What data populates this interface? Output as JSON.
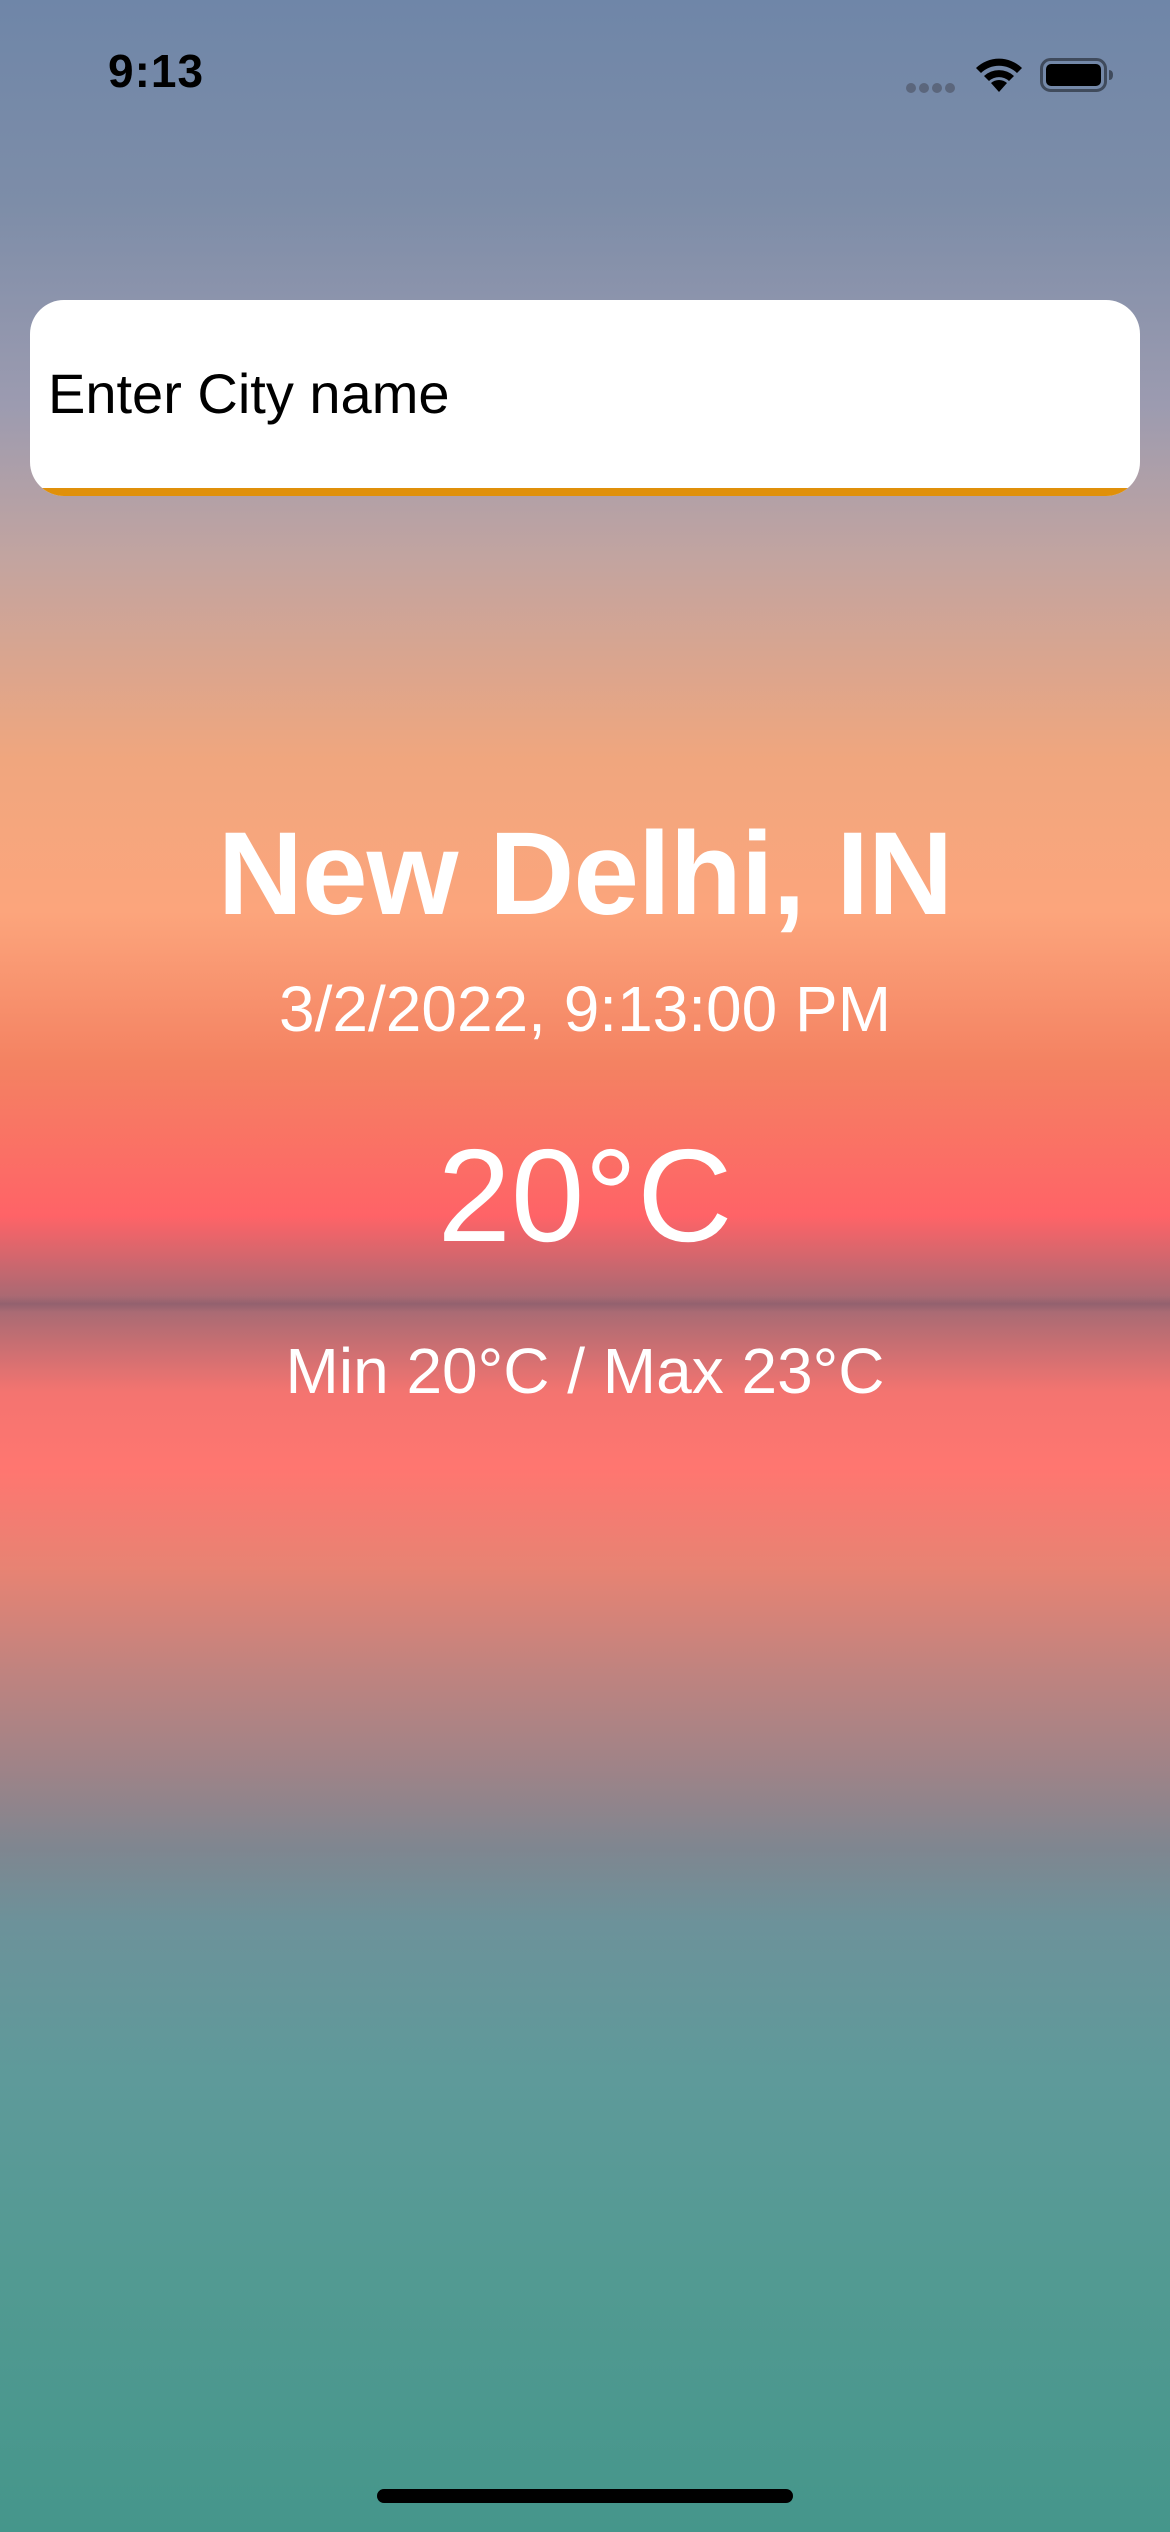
{
  "status_bar": {
    "time": "9:13",
    "signal_icon": "cellular-signal-icon",
    "wifi_icon": "wifi-icon",
    "battery_icon": "battery-icon"
  },
  "search": {
    "placeholder": "Enter City name",
    "value": "",
    "underline_color": "#e0900a"
  },
  "weather": {
    "city": "New Delhi, IN",
    "datetime": "3/2/2022, 9:13:00 PM",
    "temperature": "20°C",
    "min_max": "Min 20°C / Max 23°C"
  },
  "colors": {
    "text": "#ffffff",
    "search_bg": "#ffffff"
  }
}
